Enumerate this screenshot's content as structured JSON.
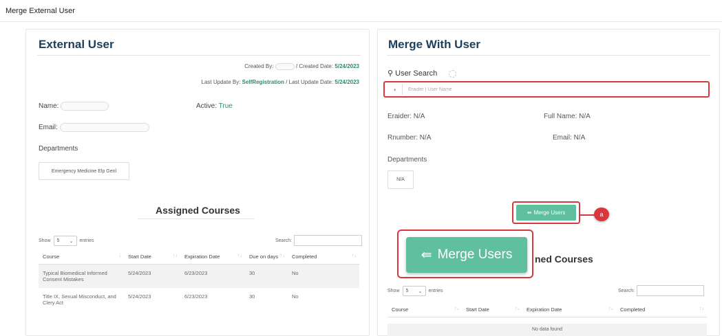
{
  "page": {
    "title": "Merge External User"
  },
  "external_user": {
    "heading": "External User",
    "created_by_label": "Created By:",
    "created_date_label": "/ Created Date:",
    "created_date": "5/24/2023",
    "last_update_by_label": "Last Update By:",
    "last_update_by": "SelfRegistration",
    "last_update_date_label": "/ Last Update Date:",
    "last_update_date": "5/24/2023",
    "name_label": "Name:",
    "email_label": "Email:",
    "active_label": "Active:",
    "active_value": "True",
    "departments_label": "Departments",
    "department": "Emergency Medicine Elp Genl",
    "assigned_courses_heading": "Assigned Courses",
    "show_label": "Show",
    "page_size": "5",
    "entries_label": "entries",
    "search_label": "Search:",
    "columns": [
      "Course",
      "Start Date",
      "Expiration Date",
      "Due on days",
      "Completed"
    ],
    "rows": [
      [
        "Typical Biomedical Informed Consent Mistakes",
        "5/24/2023",
        "6/23/2023",
        "30",
        "No"
      ],
      [
        "Title IX, Sexual Misconduct, and Clery Act",
        "5/24/2023",
        "6/23/2023",
        "30",
        "No"
      ]
    ]
  },
  "merge_user": {
    "heading": "Merge With User",
    "search_title": "User Search",
    "search_placeholder": "Eraider | User Name",
    "eraider_label": "Eraider:",
    "eraider_value": "N/A",
    "full_name_label": "Full Name:",
    "full_name_value": "N/A",
    "rnumber_label": "Rnumber:",
    "rnumber_value": "N/A",
    "email_label": "Email:",
    "email_value": "N/A",
    "departments_label": "Departments",
    "department": "N/A",
    "merge_button": "Merge Users",
    "callout": "a",
    "assigned_courses_heading_partial": "ned Courses",
    "show_label": "Show",
    "page_size": "5",
    "entries_label": "entries",
    "search_label": "Search:",
    "columns": [
      "Course",
      "Start Date",
      "Expiration Date",
      "Completed"
    ],
    "empty_text": "No data found"
  },
  "zoom": {
    "merge_button": "Merge Users"
  },
  "colors": {
    "accent": "#5fbf9f",
    "highlight": "#d9363e",
    "heading": "#1c3f5e",
    "meta_green": "#2e8a67"
  }
}
